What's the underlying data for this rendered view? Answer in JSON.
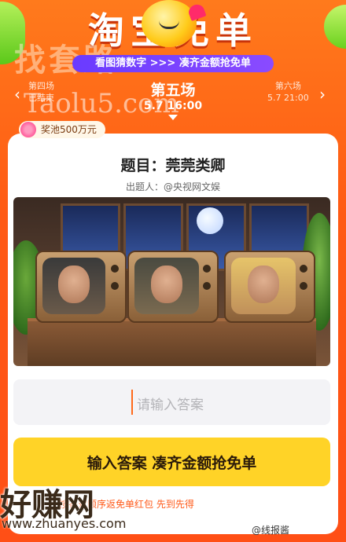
{
  "header": {
    "title": "淘宝免单",
    "subtitle": "看图猜数字 >>> 凑齐金额抢免单",
    "watermark_top": "找套路"
  },
  "rounds": {
    "prev": {
      "name": "第四场",
      "status": "已结束"
    },
    "current": {
      "name": "第五场",
      "time": "5.7 16:00"
    },
    "next": {
      "name": "第六场",
      "time": "5.7 21:00"
    }
  },
  "watermark_mid": "Taolu5.com",
  "pool": {
    "label": "奖池500万元"
  },
  "question": {
    "title": "题目：莞莞类卿",
    "author": "出题人：@央视网文娱"
  },
  "answer": {
    "placeholder": "请输入答案"
  },
  "submit": {
    "label": "输入答案 凑齐金额抢免单"
  },
  "note": "按答对顺序返免单红包 先到先得",
  "watermarks": {
    "brand": "好赚网",
    "url": "www.zhuanyes.com",
    "source": "@线报酱"
  },
  "colors": {
    "accent": "#ff5a1a",
    "button": "#ffd327",
    "card": "#ffffff"
  }
}
